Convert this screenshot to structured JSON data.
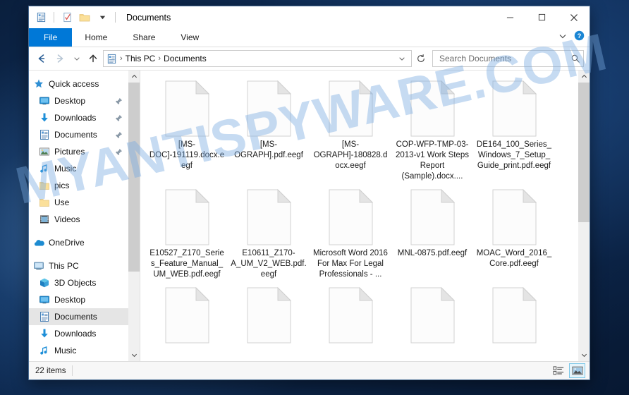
{
  "window": {
    "title": "Documents",
    "quick_access_icons": [
      "properties-icon",
      "new-folder-check-icon",
      "folder-icon",
      "chevron-down-icon"
    ],
    "controls": {
      "minimize": "minimize-icon",
      "maximize": "maximize-icon",
      "close": "close-icon"
    }
  },
  "ribbon": {
    "tabs": [
      {
        "label": "File",
        "active": true
      },
      {
        "label": "Home",
        "active": false
      },
      {
        "label": "Share",
        "active": false
      },
      {
        "label": "View",
        "active": false
      }
    ],
    "collapse_icon": "chevron-down-icon",
    "help_icon": "help-icon"
  },
  "address_bar": {
    "back_icon": "arrow-left-icon",
    "forward_icon": "arrow-right-icon",
    "recent_icon": "chevron-down-icon",
    "up_icon": "arrow-up-icon",
    "path_icon": "documents-icon",
    "crumbs": [
      "This PC",
      "Documents"
    ],
    "separator": "›",
    "dropdown_icon": "chevron-down-icon",
    "refresh_icon": "refresh-icon"
  },
  "search": {
    "placeholder": "Search Documents",
    "value": "",
    "icon": "search-icon"
  },
  "sidebar": {
    "items": [
      {
        "label": "Quick access",
        "icon": "star-pin-icon",
        "indent": 0,
        "pinned": false,
        "selected": false
      },
      {
        "label": "Desktop",
        "icon": "desktop-icon",
        "indent": 1,
        "pinned": true,
        "selected": false
      },
      {
        "label": "Downloads",
        "icon": "download-icon",
        "indent": 1,
        "pinned": true,
        "selected": false
      },
      {
        "label": "Documents",
        "icon": "documents-icon",
        "indent": 1,
        "pinned": true,
        "selected": false
      },
      {
        "label": "Pictures",
        "icon": "pictures-icon",
        "indent": 1,
        "pinned": true,
        "selected": false
      },
      {
        "label": "Music",
        "icon": "music-icon",
        "indent": 1,
        "pinned": false,
        "selected": false
      },
      {
        "label": "pics",
        "icon": "folder-icon",
        "indent": 1,
        "pinned": false,
        "selected": false
      },
      {
        "label": "Use",
        "icon": "folder-icon",
        "indent": 1,
        "pinned": false,
        "selected": false
      },
      {
        "label": "Videos",
        "icon": "videos-icon",
        "indent": 1,
        "pinned": false,
        "selected": false
      },
      {
        "label": "OneDrive",
        "icon": "onedrive-icon",
        "indent": 0,
        "pinned": false,
        "selected": false
      },
      {
        "label": "This PC",
        "icon": "thispc-icon",
        "indent": 0,
        "pinned": false,
        "selected": false
      },
      {
        "label": "3D Objects",
        "icon": "3dobjects-icon",
        "indent": 1,
        "pinned": false,
        "selected": false
      },
      {
        "label": "Desktop",
        "icon": "desktop-icon",
        "indent": 1,
        "pinned": false,
        "selected": false
      },
      {
        "label": "Documents",
        "icon": "documents-icon",
        "indent": 1,
        "pinned": false,
        "selected": true
      },
      {
        "label": "Downloads",
        "icon": "download-icon",
        "indent": 1,
        "pinned": false,
        "selected": false
      },
      {
        "label": "Music",
        "icon": "music-icon",
        "indent": 1,
        "pinned": false,
        "selected": false
      }
    ]
  },
  "files": [
    {
      "name": "[MS-DOC]-191119.docx.eegf",
      "icon": "blank-document-icon"
    },
    {
      "name": "[MS-OGRAPH].pdf.eegf",
      "icon": "blank-document-icon"
    },
    {
      "name": "[MS-OGRAPH]-180828.docx.eegf",
      "icon": "blank-document-icon"
    },
    {
      "name": "COP-WFP-TMP-03-2013-v1 Work Steps Report (Sample).docx....",
      "icon": "blank-document-icon"
    },
    {
      "name": "DE164_100_Series_Windows_7_Setup_Guide_print.pdf.eegf",
      "icon": "blank-document-icon"
    },
    {
      "name": "E10527_Z170_Series_Feature_Manual_UM_WEB.pdf.eegf",
      "icon": "blank-document-icon"
    },
    {
      "name": "E10611_Z170-A_UM_V2_WEB.pdf.eegf",
      "icon": "blank-document-icon"
    },
    {
      "name": "Microsoft Word 2016 For Max For Legal Professionals - ...",
      "icon": "blank-document-icon"
    },
    {
      "name": "MNL-0875.pdf.eegf",
      "icon": "blank-document-icon"
    },
    {
      "name": "MOAC_Word_2016_Core.pdf.eegf",
      "icon": "blank-document-icon"
    },
    {
      "name": "",
      "icon": "blank-document-icon"
    },
    {
      "name": "",
      "icon": "blank-document-icon"
    },
    {
      "name": "",
      "icon": "blank-document-icon"
    },
    {
      "name": "",
      "icon": "blank-document-icon"
    },
    {
      "name": "",
      "icon": "blank-document-icon"
    }
  ],
  "status": {
    "item_count": "22 items",
    "details_view_icon": "details-view-icon",
    "large_icons_view_icon": "large-icons-view-icon",
    "active_view": "large-icons-view-icon"
  },
  "watermark": {
    "text": "MYANTISPYWARE.COM",
    "color": "#78aae1"
  }
}
